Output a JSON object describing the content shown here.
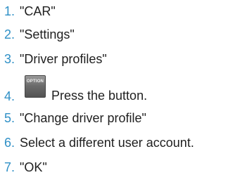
{
  "steps": [
    {
      "number": "1.",
      "text": "\"CAR\""
    },
    {
      "number": "2.",
      "text": "\"Settings\""
    },
    {
      "number": "3.",
      "text": "\"Driver profiles\""
    },
    {
      "number": "4.",
      "text": "Press the button.",
      "button_label": "OPTION",
      "button_icon": "option-button-icon"
    },
    {
      "number": "5.",
      "text": "\"Change driver profile\""
    },
    {
      "number": "6.",
      "text": "Select a different user account."
    },
    {
      "number": "7.",
      "text": "\"OK\""
    }
  ],
  "colors": {
    "number": "#2f90c6",
    "text": "#1f1f1f",
    "button": "#6c6c6c"
  }
}
